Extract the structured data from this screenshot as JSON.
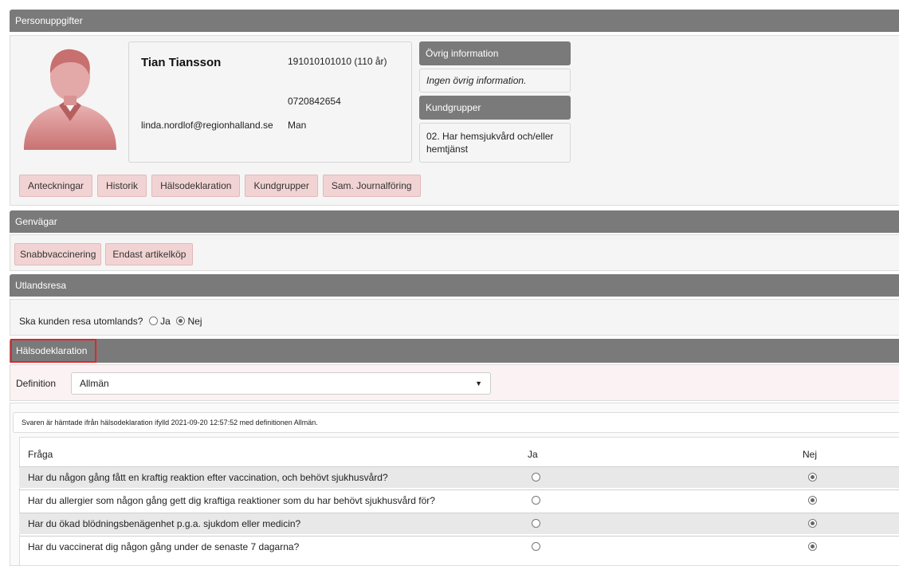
{
  "sections": {
    "personuppgifter": "Personuppgifter",
    "genvagar": "Genvägar",
    "utlandsresa": "Utlandsresa",
    "halsodeklaration": "Hälsodeklaration"
  },
  "person": {
    "name": "Tian Tiansson",
    "personnummer": "191010101010 (110 år)",
    "phone": "0720842654",
    "email": "linda.nordlof@regionhalland.se",
    "gender": "Man"
  },
  "side": {
    "ovrig_header": "Övrig information",
    "ovrig_text": "Ingen övrig information.",
    "kundgrupper_header": "Kundgrupper",
    "kundgrupper_text": "02. Har hemsjukvård och/eller hemtjänst"
  },
  "person_buttons": [
    "Anteckningar",
    "Historik",
    "Hälsodeklaration",
    "Kundgrupper",
    "Sam. Journalföring"
  ],
  "shortcut_buttons": [
    "Snabbvaccinering",
    "Endast artikelköp"
  ],
  "travel": {
    "question": "Ska kunden resa utomlands?",
    "ja": "Ja",
    "nej": "Nej",
    "selected": "Nej"
  },
  "declaration": {
    "definition_label": "Definition",
    "definition_value": "Allmän",
    "source_note": "Svaren är hämtade ifrån hälsodeklaration ifylld 2021-09-20 12:57:52 med definitionen Allmän.",
    "col_question": "Fråga",
    "col_ja": "Ja",
    "col_nej": "Nej",
    "questions": [
      {
        "text": "Har du någon gång fått en kraftig reaktion efter vaccination, och behövt sjukhusvård?",
        "answer": "Nej"
      },
      {
        "text": "Har du allergier som någon gång gett dig kraftiga reaktioner som du har behövt sjukhusvård för?",
        "answer": "Nej"
      },
      {
        "text": "Har du ökad blödningsbenägenhet p.g.a. sjukdom eller medicin?",
        "answer": "Nej"
      },
      {
        "text": "Har du vaccinerat dig någon gång under de senaste 7 dagarna?",
        "answer": "Nej"
      }
    ]
  },
  "colors": {
    "header": "#7a7a7a",
    "pill": "#f2d3d3",
    "highlight": "#e0262b"
  }
}
